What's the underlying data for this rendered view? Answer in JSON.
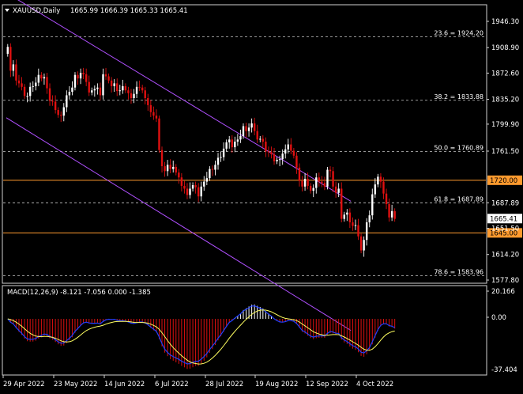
{
  "chart_header": {
    "symbol_timeframe": "XAUUSD,Daily",
    "ohlc": "1665.99 1666.39 1665.33 1665.41"
  },
  "macd": {
    "label": "MACD(12,26,9) -8.121 -7.056 0.000 -1.385",
    "axis_labels": [
      "20.166",
      "0.00",
      "-37.404"
    ]
  },
  "colors": {
    "background": "#000000",
    "bull": "#ffffff",
    "bear": "#e01010",
    "channel": "#b050ff",
    "hline": "#ff9a2e",
    "macd_main": "#2040ff",
    "macd_signal": "#ffff60",
    "grid": "#c8c8c8"
  },
  "chart_data": {
    "type": "candlestick",
    "price_axis_ticks": [
      "1946.30",
      "1908.90",
      "1872.60",
      "1835.20",
      "1799.90",
      "1761.50",
      "1687.89",
      "1651.50",
      "1614.20",
      "1577.80"
    ],
    "time_axis_labels": [
      "29 Apr 2022",
      "23 May 2022",
      "14 Jun 2022",
      "6 Jul 2022",
      "28 Jul 2022",
      "19 Aug 2022",
      "12 Sep 2022",
      "4 Oct 2022"
    ],
    "fibonacci_levels": [
      {
        "label": "23.6 = 1924.20",
        "price": 1924.2
      },
      {
        "label": "38.2 = 1833.88",
        "price": 1833.88
      },
      {
        "label": "50.0 = 1760.89",
        "price": 1760.89
      },
      {
        "label": "61.8 = 1687.89",
        "price": 1687.89
      },
      {
        "label": "78.6 = 1583.96",
        "price": 1583.96
      }
    ],
    "horizontal_lines": [
      {
        "label": "1720.00",
        "price": 1720.0
      },
      {
        "label": "1645.00",
        "price": 1645.0
      }
    ],
    "current_price": {
      "label": "1665.41",
      "price": 1665.41
    },
    "channel_upper": [
      {
        "date": "2022-04-29",
        "price": 1987
      },
      {
        "date": "2022-10-18",
        "price": 1690
      }
    ],
    "channel_lower": [
      {
        "date": "2022-04-29",
        "price": 1809
      },
      {
        "date": "2022-10-18",
        "price": 1506
      }
    ],
    "closes": [
      1910,
      1876,
      1885,
      1862,
      1858,
      1853,
      1840,
      1840,
      1853,
      1854,
      1859,
      1870,
      1865,
      1867,
      1851,
      1833,
      1832,
      1820,
      1813,
      1812,
      1824,
      1841,
      1846,
      1852,
      1870,
      1865,
      1873,
      1871,
      1860,
      1845,
      1848,
      1850,
      1852,
      1841,
      1871,
      1868,
      1862,
      1854,
      1858,
      1847,
      1848,
      1854,
      1848,
      1844,
      1837,
      1843,
      1853,
      1852,
      1848,
      1837,
      1827,
      1817,
      1812,
      1808,
      1763,
      1740,
      1733,
      1742,
      1736,
      1739,
      1731,
      1724,
      1712,
      1708,
      1699,
      1708,
      1713,
      1710,
      1697,
      1711,
      1718,
      1723,
      1736,
      1735,
      1742,
      1752,
      1753,
      1765,
      1774,
      1778,
      1767,
      1775,
      1778,
      1783,
      1797,
      1790,
      1795,
      1801,
      1790,
      1778,
      1779,
      1775,
      1761,
      1760,
      1757,
      1747,
      1749,
      1750,
      1758,
      1764,
      1771,
      1762,
      1755,
      1738,
      1719,
      1711,
      1722,
      1712,
      1705,
      1709,
      1724,
      1718,
      1716,
      1711,
      1735,
      1733,
      1711,
      1702,
      1708,
      1665,
      1671,
      1674,
      1660,
      1655,
      1656,
      1640,
      1620,
      1635,
      1660,
      1670,
      1700,
      1714,
      1725,
      1718,
      1701,
      1686,
      1667,
      1676,
      1665
    ]
  }
}
